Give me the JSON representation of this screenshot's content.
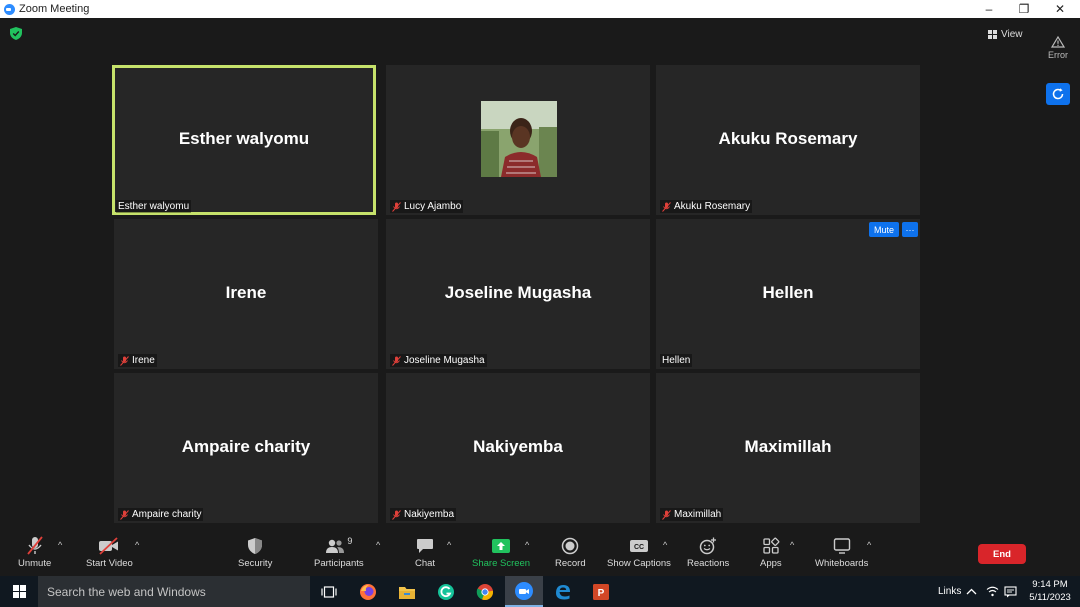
{
  "window": {
    "title": "Zoom Meeting",
    "minimize_glyph": "–",
    "maximize_glyph": "❐",
    "close_glyph": "✕"
  },
  "top": {
    "view_label": "View",
    "error_label": "Error"
  },
  "tiles": [
    {
      "big_name": "Esther walyomu",
      "label": "Esther walyomu",
      "muted": false,
      "active": true
    },
    {
      "big_name": "",
      "label": "Lucy Ajambo",
      "muted": true,
      "active": false,
      "photo": true
    },
    {
      "big_name": "Akuku Rosemary",
      "label": "Akuku Rosemary",
      "muted": true,
      "active": false
    },
    {
      "big_name": "Irene",
      "label": "Irene",
      "muted": true,
      "active": false
    },
    {
      "big_name": "Joseline Mugasha",
      "label": "Joseline Mugasha",
      "muted": true,
      "active": false
    },
    {
      "big_name": "Hellen",
      "label": "Hellen",
      "muted": false,
      "active": false,
      "hover_tools": true
    },
    {
      "big_name": "Ampaire charity",
      "label": "Ampaire charity",
      "muted": true,
      "active": false
    },
    {
      "big_name": "Nakiyemba",
      "label": "Nakiyemba",
      "muted": true,
      "active": false
    },
    {
      "big_name": "Maximillah",
      "label": "Maximillah",
      "muted": true,
      "active": false
    }
  ],
  "hover_tools": {
    "mute_label": "Mute",
    "more_label": "···"
  },
  "toolbar": {
    "unmute": "Unmute",
    "start_video": "Start Video",
    "security": "Security",
    "participants": "Participants",
    "participants_count": "9",
    "chat": "Chat",
    "share_screen": "Share Screen",
    "record": "Record",
    "show_captions": "Show Captions",
    "reactions": "Reactions",
    "apps": "Apps",
    "whiteboards": "Whiteboards",
    "end": "End",
    "caret": "^"
  },
  "taskbar": {
    "search_placeholder": "Search the web and Windows",
    "links_label": "Links",
    "time": "9:14 PM",
    "date": "5/11/2023"
  },
  "colors": {
    "active_speaker_border": "#c6e26b",
    "zoom_blue": "#0e72ed",
    "share_green": "#21c25e",
    "end_red": "#d9252a",
    "muted_red": "#e0403a"
  }
}
